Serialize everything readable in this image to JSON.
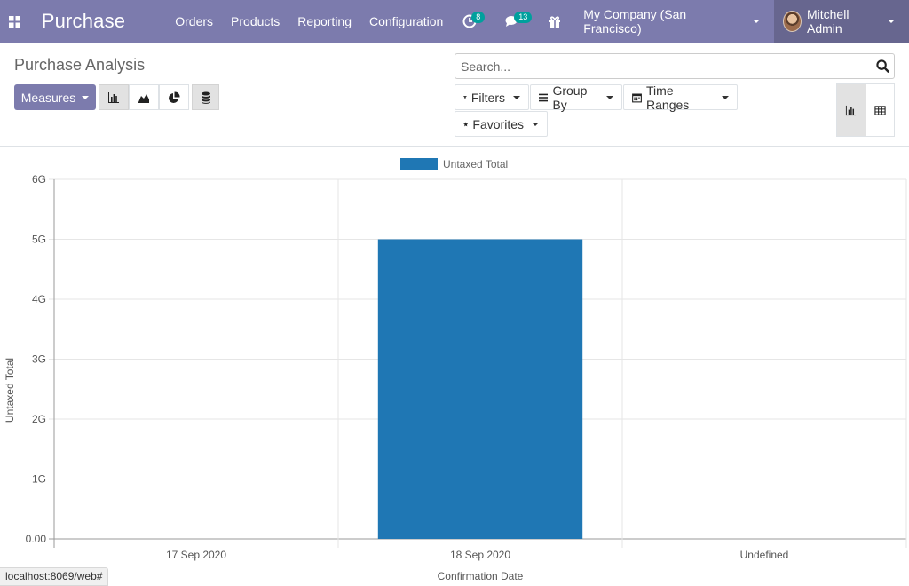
{
  "navbar": {
    "brand": "Purchase",
    "menu": [
      "Orders",
      "Products",
      "Reporting",
      "Configuration"
    ],
    "activity_count": "8",
    "messages_count": "13",
    "company": "My Company (San Francisco)",
    "user": "Mitchell Admin"
  },
  "control_panel": {
    "title": "Purchase Analysis",
    "measures_label": "Measures",
    "search_placeholder": "Search...",
    "filters_label": "Filters",
    "group_by_label": "Group By",
    "time_ranges_label": "Time Ranges",
    "favorites_label": "Favorites"
  },
  "colors": {
    "navbar": "#7c7bad",
    "user_menu": "#67668f",
    "badge": "#00a09d",
    "bar": "#1f77b4"
  },
  "chart_data": {
    "type": "bar",
    "categories": [
      "17 Sep 2020",
      "18 Sep 2020",
      "Undefined"
    ],
    "series": [
      {
        "name": "Untaxed Total",
        "values": [
          0,
          5000000000,
          0
        ]
      }
    ],
    "xlabel": "Confirmation Date",
    "ylabel": "Untaxed Total",
    "ylim": [
      0,
      6000000000
    ],
    "yticks": [
      0,
      1000000000,
      2000000000,
      3000000000,
      4000000000,
      5000000000,
      6000000000
    ],
    "ytick_labels": [
      "0.00",
      "1G",
      "2G",
      "3G",
      "4G",
      "5G",
      "6G"
    ],
    "grid": true,
    "legend": "top-center"
  },
  "status_bar": {
    "url": "localhost:8069/web#"
  }
}
